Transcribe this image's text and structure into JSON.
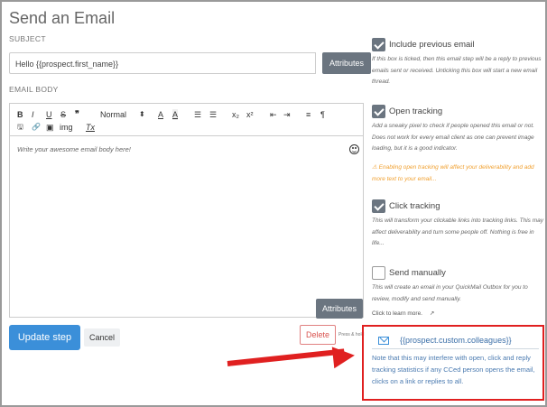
{
  "title": "Send an Email",
  "subject": {
    "label": "SUBJECT",
    "value": "Hello {{prospect.first_name}}",
    "attributes_label": "Attributes"
  },
  "body": {
    "label": "EMAIL BODY",
    "placeholder": "Write your awesome email body here!",
    "attributes_label": "Attributes",
    "toolbar": {
      "bold": "B",
      "italic": "I",
      "underline": "U",
      "strike": "S",
      "quote": "❞",
      "style": "Normal",
      "style_arrow": "⬍",
      "font_color": "A",
      "highlight": "A",
      "ol": "☰",
      "ul": "☰",
      "sub": "x₂",
      "sup": "x²",
      "outdent": "⇤",
      "indent": "⇥",
      "align": "≡",
      "rtl": "¶",
      "save": "🖫",
      "link": "🔗",
      "image": "▣",
      "img": "img",
      "clear": "Tx"
    }
  },
  "actions": {
    "update": "Update step",
    "cancel": "Cancel",
    "delete": "Delete",
    "press_hold": "Press & hold"
  },
  "options": {
    "include_previous": {
      "title": "Include previous email",
      "checked": true,
      "desc": "If this box is ticked, then this email step will be a reply to previous emails sent or received. Unticking this box will start a new email thread."
    },
    "open_tracking": {
      "title": "Open tracking",
      "checked": true,
      "desc": "Add a sneaky pixel to check if people opened this email or not. Does not work for every email client as one can prevent image loading, but it is a good indicator.",
      "warning": "⚠ Enabling open tracking will affect your deliverability and add more text to your email..."
    },
    "click_tracking": {
      "title": "Click tracking",
      "checked": true,
      "desc": "This will transform your clickable links into tracking links. This may affect deliverability and turn some people off. Nothing is free in life..."
    },
    "send_manually": {
      "title": "Send manually",
      "checked": false,
      "desc": "This will create an email in your QuickMail Outbox for you to review, modify and send manually.",
      "learn": "Click to learn more.",
      "learn_icon": "↗"
    }
  },
  "cc": {
    "variable": "{{prospect.custom.colleagues}}",
    "note": "Note that this may interfere with open, click and reply tracking statistics if any CCed person opens the email, clicks on a link or replies to all."
  },
  "colors": {
    "primary": "#3b8fd9",
    "danger": "#d9534f",
    "annotation": "#e02020",
    "warning": "#f0a030"
  }
}
